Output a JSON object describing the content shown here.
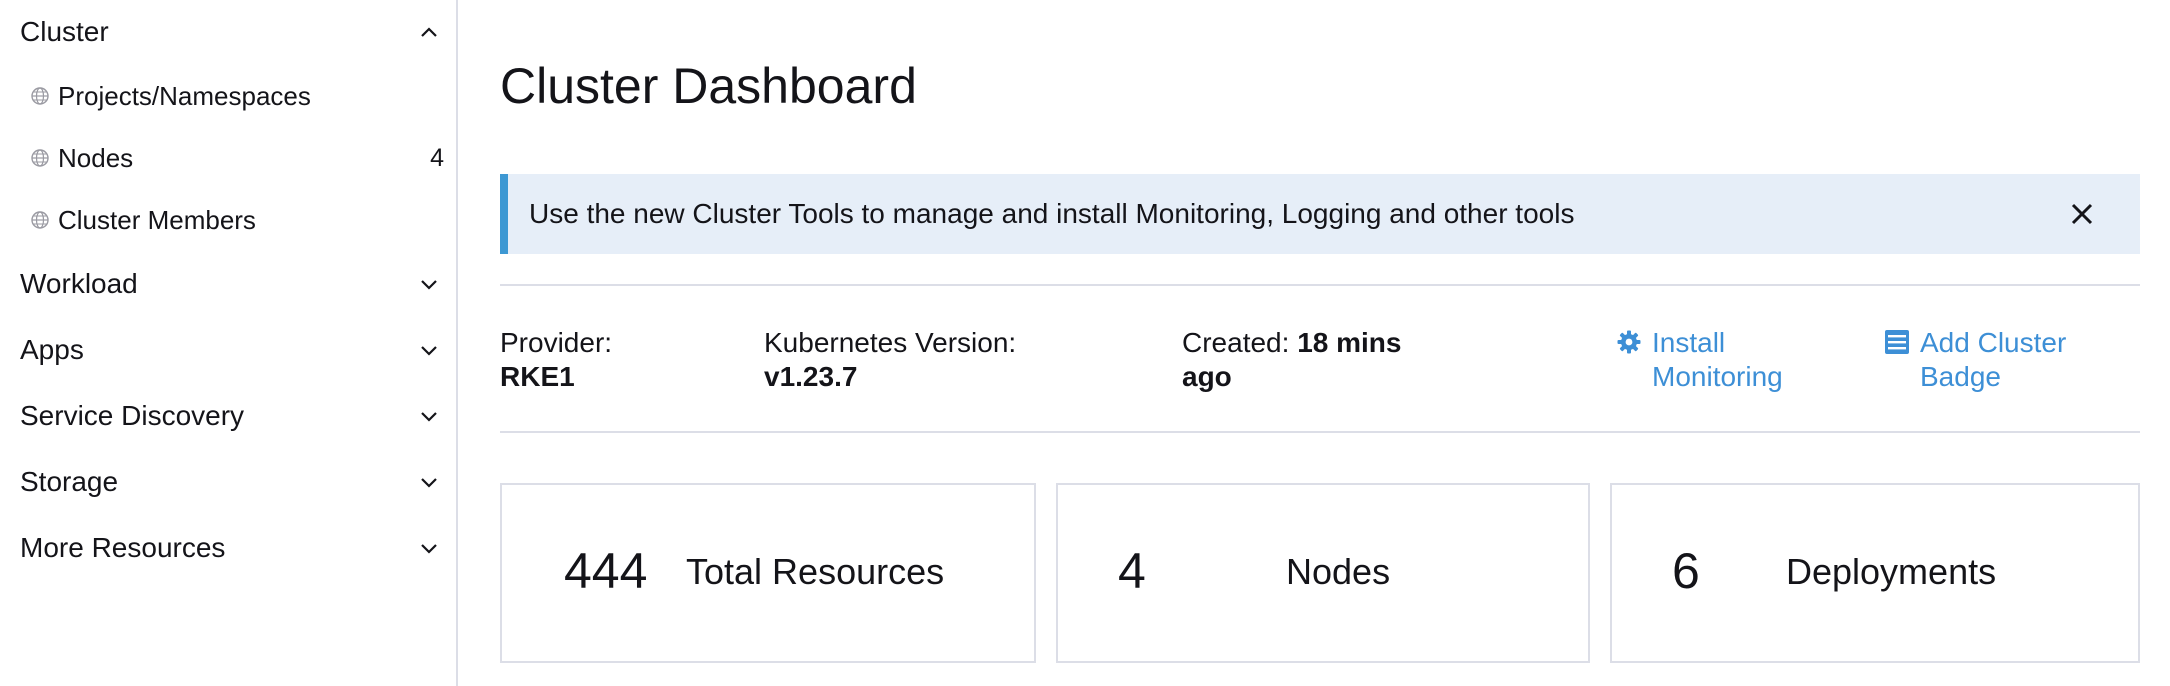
{
  "sidebar": {
    "cluster": {
      "label": "Cluster",
      "expanded": true,
      "chevron": "chevron-up-icon"
    },
    "cluster_items": [
      {
        "label": "Projects/Namespaces",
        "icon": "globe-icon",
        "count": ""
      },
      {
        "label": "Nodes",
        "icon": "globe-icon",
        "count": "4"
      },
      {
        "label": "Cluster Members",
        "icon": "globe-icon",
        "count": ""
      }
    ],
    "groups": [
      {
        "label": "Workload",
        "chevron": "chevron-down-icon"
      },
      {
        "label": "Apps",
        "chevron": "chevron-down-icon"
      },
      {
        "label": "Service Discovery",
        "chevron": "chevron-down-icon"
      },
      {
        "label": "Storage",
        "chevron": "chevron-down-icon"
      },
      {
        "label": "More Resources",
        "chevron": "chevron-down-icon"
      }
    ]
  },
  "main": {
    "title": "Cluster Dashboard",
    "banner": {
      "text": "Use the new Cluster Tools to manage and install Monitoring, Logging and other tools",
      "close_icon": "close-icon"
    },
    "info": {
      "provider_label": "Provider:",
      "provider_value": "RKE1",
      "k8s_label": "Kubernetes Version:",
      "k8s_value": "v1.23.7",
      "created_label": "Created:",
      "created_value_line1": "18 mins",
      "created_value_line2": "ago"
    },
    "actions": [
      {
        "line1": "Install",
        "line2": "Monitoring",
        "icon": "gear-icon"
      },
      {
        "line1": "Add Cluster",
        "line2": "Badge",
        "icon": "badge-icon"
      }
    ],
    "cards": [
      {
        "count": "444",
        "label": "Total Resources"
      },
      {
        "count": "4",
        "label": "Nodes"
      },
      {
        "count": "6",
        "label": "Deployments"
      }
    ]
  },
  "colors": {
    "accent": "#3d98d3",
    "link": "#3d8fd6",
    "banner_bg": "#e6eef8",
    "border": "#dcdee7",
    "text": "#141419"
  }
}
